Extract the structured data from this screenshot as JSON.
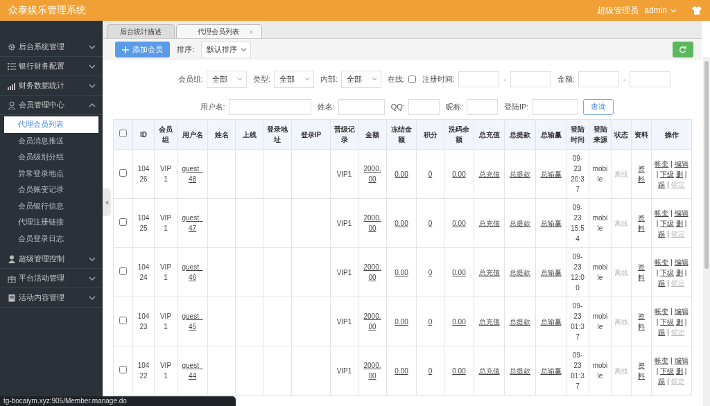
{
  "app_title": "众泰娱乐管理系统",
  "user": {
    "role": "超级管理员",
    "name": "admin"
  },
  "sidebar": [
    {
      "label": "后台系统管理",
      "expanded": false
    },
    {
      "label": "银行财务配置",
      "expanded": false
    },
    {
      "label": "财务数据统计",
      "expanded": false
    },
    {
      "label": "会员管理中心",
      "expanded": true,
      "children": [
        {
          "label": "代理会员列表",
          "selected": true
        },
        {
          "label": "会员消息推送",
          "selected": false
        },
        {
          "label": "会员级别分组",
          "selected": false
        },
        {
          "label": "异常登录地点",
          "selected": false
        },
        {
          "label": "会员账变记录",
          "selected": false
        },
        {
          "label": "会员银行信息",
          "selected": false
        },
        {
          "label": "代理注册链接",
          "selected": false
        },
        {
          "label": "会员登录日志",
          "selected": false
        }
      ]
    },
    {
      "label": "超级管理控制",
      "expanded": false
    },
    {
      "label": "平台活动管理",
      "expanded": false
    },
    {
      "label": "活动内容管理",
      "expanded": false
    }
  ],
  "tabs": [
    {
      "label": "后台统计描述",
      "selected": false
    },
    {
      "label": "代理会员列表",
      "selected": true,
      "close": "×"
    }
  ],
  "toolbar": {
    "add_button": "添加会员",
    "sort_label": "排序:",
    "sort_value": "默认排序"
  },
  "filters": {
    "row_1": [
      {
        "kind": "select",
        "label": "会员组:",
        "value": "全部"
      },
      {
        "kind": "select",
        "label": "类型:",
        "value": "全部"
      },
      {
        "kind": "select",
        "label": "内部:",
        "value": "全部"
      },
      {
        "kind": "checkbox",
        "label": "在线:",
        "checked": false
      },
      {
        "kind": "range",
        "label": "注册时间:",
        "separator": "-"
      },
      {
        "kind": "range",
        "label": "金额:",
        "separator": "-"
      }
    ],
    "row_2": [
      {
        "kind": "input",
        "label": "用户名:"
      },
      {
        "kind": "input",
        "label": "姓名:"
      },
      {
        "kind": "input",
        "label": "QQ:"
      },
      {
        "kind": "input",
        "label": "昵称:"
      },
      {
        "kind": "input",
        "label": "登陆IP:"
      }
    ],
    "search_button": "查询"
  },
  "table": {
    "all_checked": false,
    "columns": [
      "ID",
      "会员组",
      "用户名",
      "姓名",
      "上线",
      "登录地址",
      "登录IP",
      "晋级记录",
      "金额",
      "冻结金额",
      "积分",
      "洗码余额",
      "总充值",
      "总提款",
      "总输赢",
      "登陆时间",
      "登陆来源",
      "状态",
      "资料",
      "操作"
    ],
    "rows": [
      {
        "checked": false,
        "id": "10426",
        "group": "VIP1",
        "username": "guest_48",
        "level": "VIP1",
        "amount": "2000.00",
        "frozen": "0.00",
        "points": "0",
        "wash": "0.00",
        "recharge": "总充值",
        "withdraw": "总提款",
        "winloss": "总输赢",
        "login_time": "09-23 20:37",
        "source": "mobile",
        "status": "离线",
        "online": false,
        "profile": "资料",
        "ops": [
          {
            "kind": "link",
            "label": "帐变",
            "disabled": false
          },
          {
            "kind": "separator",
            "text": "|"
          },
          {
            "kind": "link",
            "label": "编辑",
            "disabled": false
          },
          {
            "kind": "separator",
            "text": "|"
          },
          {
            "kind": "link",
            "label": "下级",
            "disabled": false
          },
          {
            "kind": "link",
            "label": "删",
            "disabled": false
          },
          {
            "kind": "separator",
            "text": "|"
          },
          {
            "kind": "link",
            "label": "踢",
            "disabled": false
          },
          {
            "kind": "separator",
            "text": "|"
          },
          {
            "kind": "link",
            "label": "锁定",
            "disabled": true
          }
        ]
      },
      {
        "checked": false,
        "id": "10425",
        "group": "VIP1",
        "username": "guest_47",
        "level": "VIP1",
        "amount": "2000.00",
        "frozen": "0.00",
        "points": "0",
        "wash": "0.00",
        "recharge": "总充值",
        "withdraw": "总提款",
        "winloss": "总输赢",
        "login_time": "09-23 15:54",
        "source": "mobile",
        "status": "离线",
        "online": false,
        "profile": "资料",
        "ops": [
          {
            "kind": "link",
            "label": "帐变",
            "disabled": false
          },
          {
            "kind": "separator",
            "text": "|"
          },
          {
            "kind": "link",
            "label": "编辑",
            "disabled": false
          },
          {
            "kind": "separator",
            "text": "|"
          },
          {
            "kind": "link",
            "label": "下级",
            "disabled": false
          },
          {
            "kind": "link",
            "label": "删",
            "disabled": false
          },
          {
            "kind": "separator",
            "text": "|"
          },
          {
            "kind": "link",
            "label": "踢",
            "disabled": false
          },
          {
            "kind": "separator",
            "text": "|"
          },
          {
            "kind": "link",
            "label": "锁定",
            "disabled": true
          }
        ]
      },
      {
        "checked": false,
        "id": "10424",
        "group": "VIP1",
        "username": "guest_46",
        "level": "VIP1",
        "amount": "2000.00",
        "frozen": "0.00",
        "points": "0",
        "wash": "0.00",
        "recharge": "总充值",
        "withdraw": "总提款",
        "winloss": "总输赢",
        "login_time": "09-23 12:00",
        "source": "mobile",
        "status": "离线",
        "online": false,
        "profile": "资料",
        "ops": [
          {
            "kind": "link",
            "label": "帐变",
            "disabled": false
          },
          {
            "kind": "separator",
            "text": "|"
          },
          {
            "kind": "link",
            "label": "编辑",
            "disabled": false
          },
          {
            "kind": "separator",
            "text": "|"
          },
          {
            "kind": "link",
            "label": "下级",
            "disabled": false
          },
          {
            "kind": "link",
            "label": "删",
            "disabled": false
          },
          {
            "kind": "separator",
            "text": "|"
          },
          {
            "kind": "link",
            "label": "踢",
            "disabled": false
          },
          {
            "kind": "separator",
            "text": "|"
          },
          {
            "kind": "link",
            "label": "锁定",
            "disabled": true
          }
        ]
      },
      {
        "checked": false,
        "id": "10423",
        "group": "VIP1",
        "username": "guest_45",
        "level": "VIP1",
        "amount": "2000.00",
        "frozen": "0.00",
        "points": "0",
        "wash": "0.00",
        "recharge": "总充值",
        "withdraw": "总提款",
        "winloss": "总输赢",
        "login_time": "09-23 01:37",
        "source": "mobile",
        "status": "离线",
        "online": false,
        "profile": "资料",
        "ops": [
          {
            "kind": "link",
            "label": "帐变",
            "disabled": false
          },
          {
            "kind": "separator",
            "text": "|"
          },
          {
            "kind": "link",
            "label": "编辑",
            "disabled": false
          },
          {
            "kind": "separator",
            "text": "|"
          },
          {
            "kind": "link",
            "label": "下级",
            "disabled": false
          },
          {
            "kind": "link",
            "label": "删",
            "disabled": false
          },
          {
            "kind": "separator",
            "text": "|"
          },
          {
            "kind": "link",
            "label": "踢",
            "disabled": false
          },
          {
            "kind": "separator",
            "text": "|"
          },
          {
            "kind": "link",
            "label": "锁定",
            "disabled": true
          }
        ]
      },
      {
        "checked": false,
        "id": "10422",
        "group": "VIP1",
        "username": "guest_44",
        "level": "VIP1",
        "amount": "2000.00",
        "frozen": "0.00",
        "points": "0",
        "wash": "0.00",
        "recharge": "总充值",
        "withdraw": "总提款",
        "winloss": "总输赢",
        "login_time": "09-23 01:37",
        "source": "mobile",
        "status": "离线",
        "online": false,
        "profile": "资料",
        "ops": [
          {
            "kind": "link",
            "label": "帐变",
            "disabled": false
          },
          {
            "kind": "separator",
            "text": "|"
          },
          {
            "kind": "link",
            "label": "编辑",
            "disabled": false
          },
          {
            "kind": "separator",
            "text": "|"
          },
          {
            "kind": "link",
            "label": "下级",
            "disabled": false
          },
          {
            "kind": "link",
            "label": "删",
            "disabled": false
          },
          {
            "kind": "separator",
            "text": "|"
          },
          {
            "kind": "link",
            "label": "踢",
            "disabled": false
          },
          {
            "kind": "separator",
            "text": "|"
          },
          {
            "kind": "link",
            "label": "锁定",
            "disabled": true
          }
        ]
      }
    ]
  },
  "status_url": "tg-bocaiym.xyz:905/Member.manage.do"
}
